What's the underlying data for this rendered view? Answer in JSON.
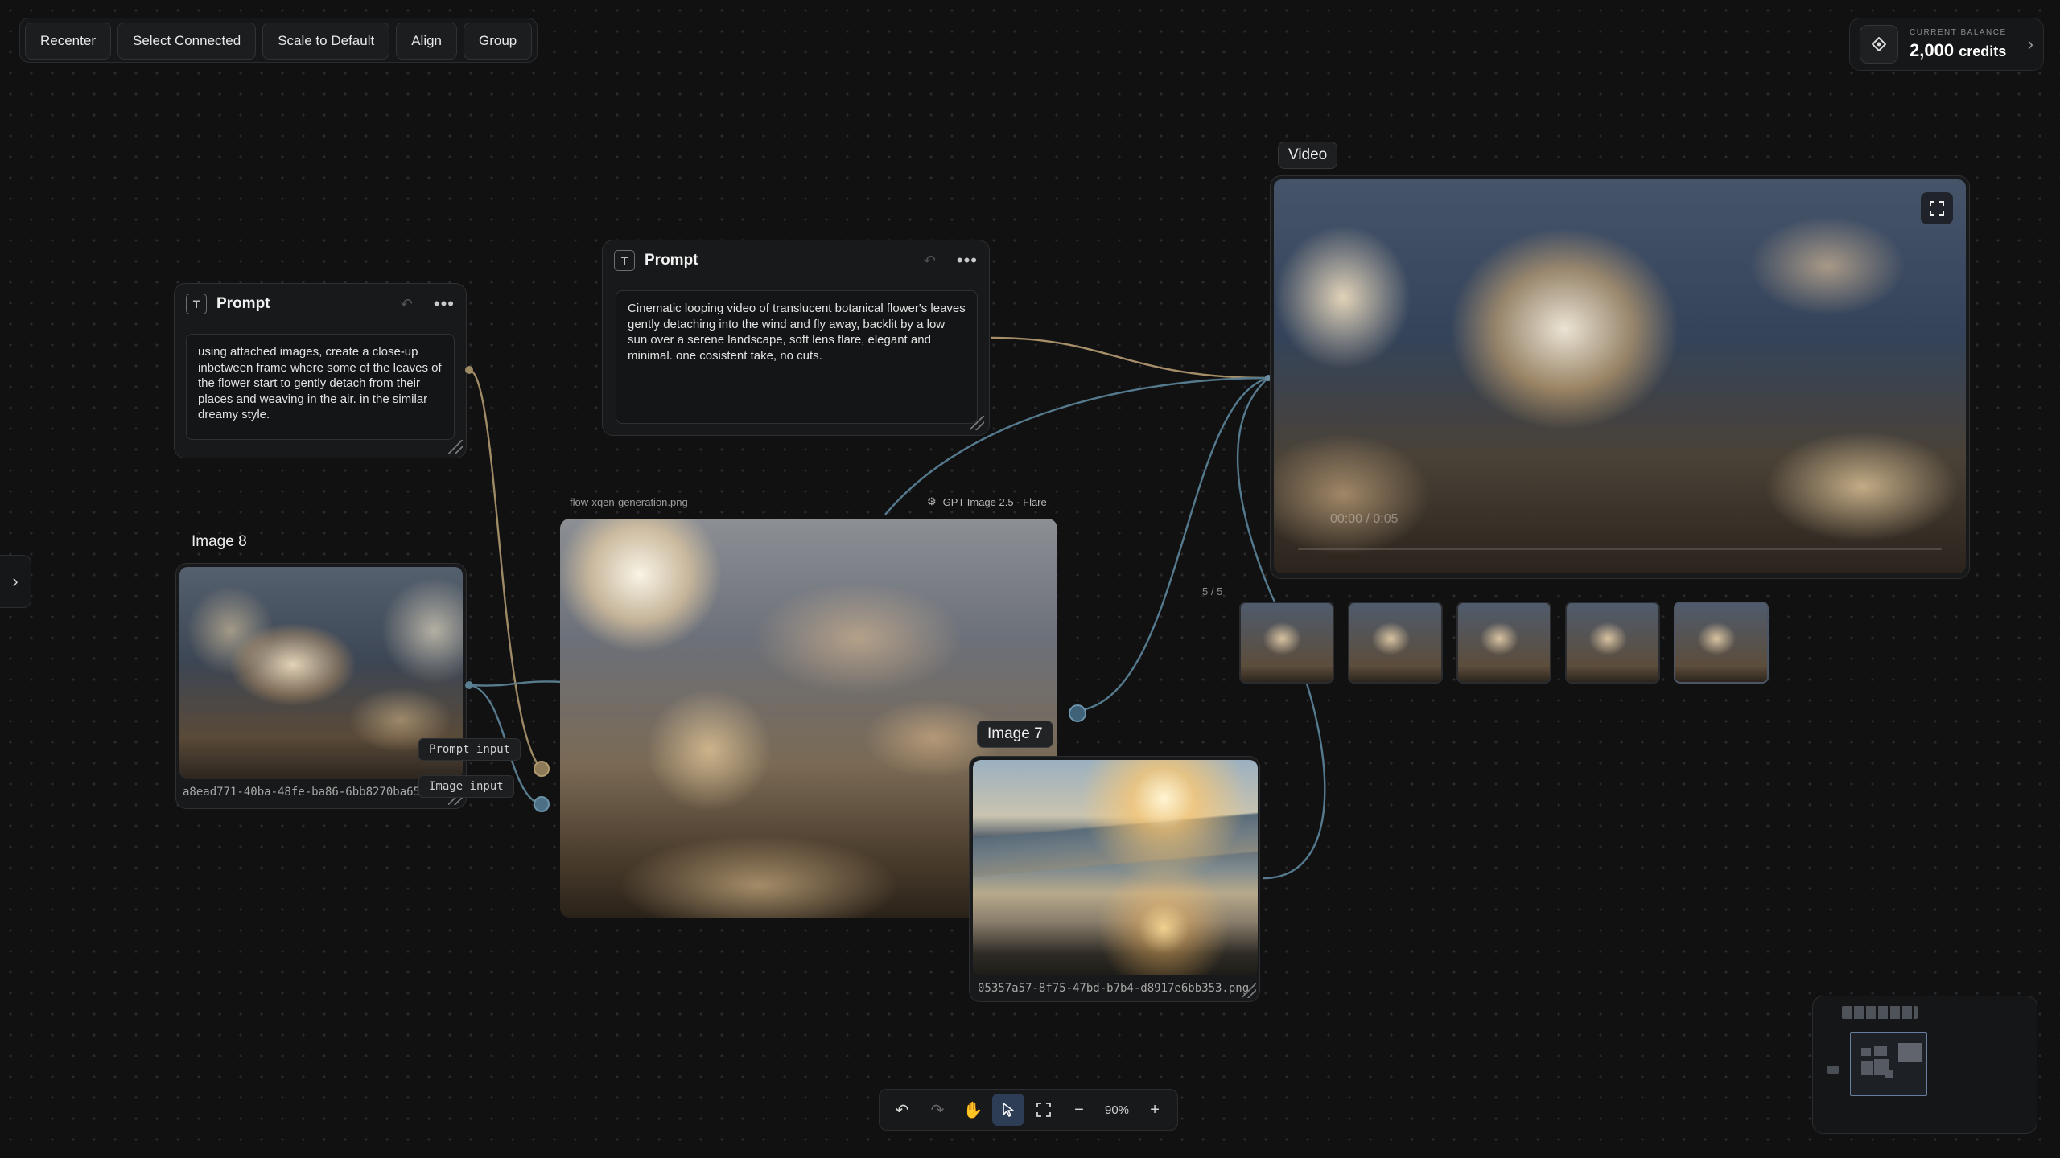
{
  "toolbar": {
    "buttons": [
      "Recenter",
      "Select Connected",
      "Scale to Default",
      "Align",
      "Group"
    ]
  },
  "balance": {
    "caption": "CURRENT BALANCE",
    "amount": "2,000",
    "unit": "credits"
  },
  "prompt_left": {
    "title": "Prompt",
    "text": "using attached images, create a  close-up inbetween frame where some of the leaves of the flower start to gently detach from their places and weaving in the air.  in the similar dreamy style."
  },
  "prompt_center": {
    "title": "Prompt",
    "text": "Cinematic looping video of translucent botanical flower's leaves gently detaching  into the wind and fly away, backlit by a low sun over a serene landscape, soft lens flare, elegant and minimal. one cosistent take, no cuts."
  },
  "image8": {
    "label": "Image 8",
    "filename": "a8ead771-40ba-48fe-ba86-6bb8270ba65..."
  },
  "generation": {
    "filename": "flow-xqen-generation.png",
    "model": "GPT Image 2.5 · Flare",
    "ports": [
      "Prompt input",
      "Image input"
    ]
  },
  "image7": {
    "label": "Image 7",
    "filename": "05357a57-8f75-47bd-b7b4-d8917e6bb353.png"
  },
  "video": {
    "label": "Video",
    "timecode": "00:00 / 0:05",
    "page_indicator": "5 / 5",
    "thumbnail_count": 5,
    "selected_thumbnail": 5
  },
  "zoom": {
    "value": "90%"
  },
  "icons": {
    "balance": "diamond-icon",
    "sidebar_toggle": "chevron-right-icon",
    "expand": "fullscreen-icon"
  },
  "colors": {
    "background": "#111112",
    "wire_gold": "#b89a6a",
    "wire_blue": "#5b7f93",
    "accent_active": "#2d3d55"
  }
}
